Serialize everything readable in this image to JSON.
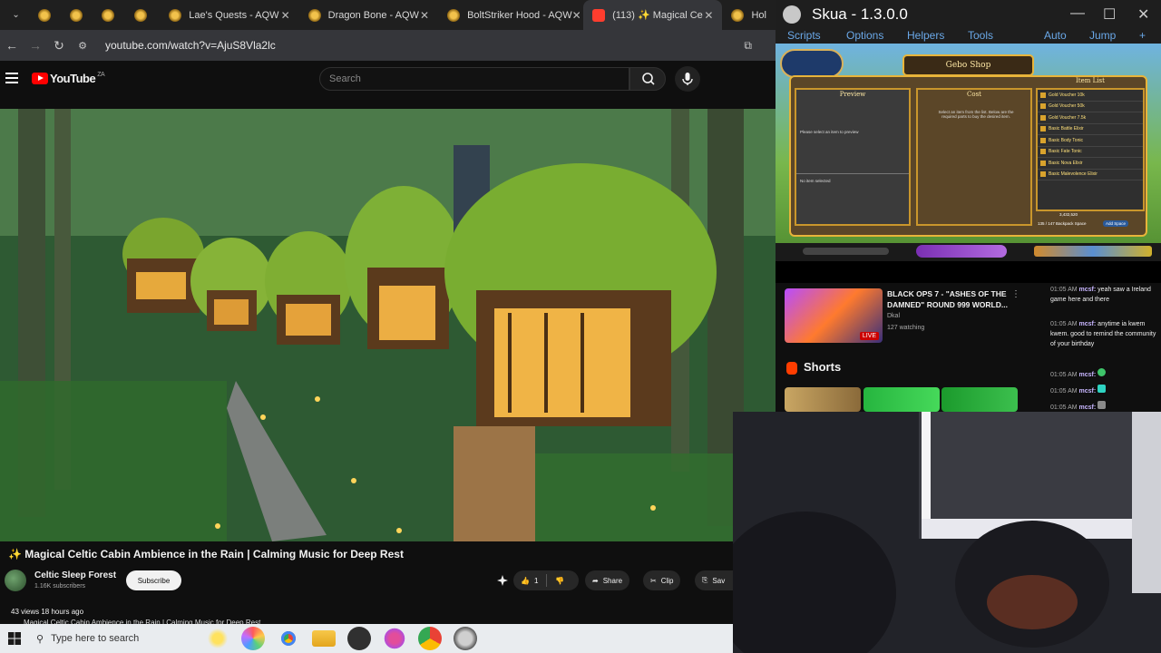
{
  "browser": {
    "tabs": [
      {
        "label": "",
        "kind": "aqw"
      },
      {
        "label": "",
        "kind": "aqw"
      },
      {
        "label": "",
        "kind": "aqw"
      },
      {
        "label": "",
        "kind": "aqw"
      },
      {
        "label": "Lae's Quests - AQW",
        "kind": "aqw",
        "close": "✕"
      },
      {
        "label": "Dragon Bone - AQW",
        "kind": "aqw",
        "close": "✕"
      },
      {
        "label": "BoltStriker Hood - AQW",
        "kind": "aqw",
        "close": "✕"
      },
      {
        "label": "(113) ✨ Magical Ce",
        "kind": "yt",
        "close": "✕",
        "active": true
      },
      {
        "label": "Hol",
        "kind": "aqw"
      }
    ],
    "url": "youtube.com/watch?v=AjuS8Vla2lc"
  },
  "youtube": {
    "logo_text": "YouTube",
    "country": "ZA",
    "search_placeholder": "Search",
    "video_title": "✨ Magical Celtic Cabin Ambience in the Rain | Calming Music for Deep Rest",
    "channel_name": "Celtic Sleep Forest",
    "subscribers": "1.16K subscribers",
    "subscribe_label": "Subscribe",
    "like_count": "1",
    "share_label": "Share",
    "clip_label": "Clip",
    "save_label": "Sav",
    "views": "43 views  18 hours ago",
    "description_peek": "Magical Celtic Cabin Ambience in the Rain | Calming Music for Deep Rest",
    "live_title": "BLACK OPS 7 - \"ASHES OF THE DAMNED\" ROUND 999 WORLD...",
    "live_channel": "Dkal",
    "live_viewers": "127 watching",
    "live_badge": "LIVE",
    "shorts_label": "Shorts",
    "chat": [
      {
        "time": "01:05 AM",
        "user": "mcsf:",
        "text": "yeah saw a Ireland game here and there"
      },
      {
        "time": "01:05 AM",
        "user": "mcsf:",
        "text": "anytime ia kwem kwem. good to remind the community of your birthday"
      },
      {
        "time": "01:05 AM",
        "user": "mcsf:",
        "text": ""
      },
      {
        "time": "01:05 AM",
        "user": "mcsf:",
        "text": ""
      },
      {
        "time": "01:05 AM",
        "user": "mcsf:",
        "text": ""
      }
    ]
  },
  "skua": {
    "title": "Skua - 1.3.0.0",
    "menus": [
      "Scripts",
      "Options",
      "Helpers",
      "Tools",
      "Auto",
      "Jump"
    ],
    "shop_name": "Gebo Shop",
    "panel_preview": "Preview",
    "panel_cost": "Cost",
    "panel_items": "Item List",
    "preview_hint": "Please select an item to preview",
    "no_item": "No item selected",
    "cost_hint": "Select an item from the list. Below are the required parts to buy the desired item.",
    "items": [
      "Gold Voucher 10k",
      "Gold Voucher 50k",
      "Gold Voucher 7.5k",
      "Basic Battle Elixir",
      "Basic Body Tonic",
      "Basic Fate Tonic",
      "Basic Nova Elixir",
      "Basic Malevolence Elixir"
    ],
    "gold": "3,432,520",
    "backpack": "135 / 147 Backpack Space",
    "add_space": "Add Space"
  },
  "taskbar": {
    "search_placeholder": "Type here to search"
  }
}
